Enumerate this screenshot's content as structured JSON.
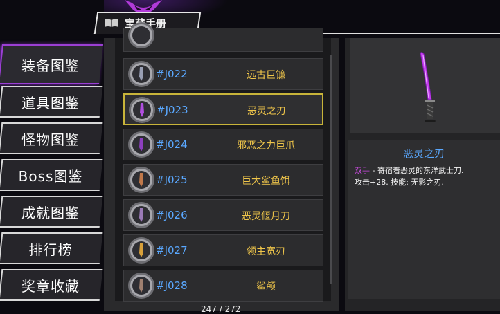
{
  "header": {
    "title": "宝藏手册"
  },
  "nav": [
    {
      "label": "装备图鉴",
      "active": true
    },
    {
      "label": "道具图鉴",
      "active": false
    },
    {
      "label": "怪物图鉴",
      "active": false
    },
    {
      "label": "Boss图鉴",
      "active": false
    },
    {
      "label": "成就图鉴",
      "active": false
    },
    {
      "label": "排行榜",
      "active": false
    },
    {
      "label": "奖章收藏",
      "active": false
    }
  ],
  "items": [
    {
      "code": "#J022",
      "name": "远古巨镰",
      "icon": "scythe-icon",
      "color": "#9aa0b5"
    },
    {
      "code": "#J023",
      "name": "恶灵之刃",
      "icon": "katana-icon",
      "color": "#b04ee0"
    },
    {
      "code": "#J024",
      "name": "邪恶之力巨爪",
      "icon": "claw-icon",
      "color": "#8d3fc0"
    },
    {
      "code": "#J025",
      "name": "巨大鲨鱼饵",
      "icon": "bait-icon",
      "color": "#c0784a"
    },
    {
      "code": "#J026",
      "name": "恶灵偃月刀",
      "icon": "glaive-icon",
      "color": "#9b7ab8"
    },
    {
      "code": "#J027",
      "name": "领主宽刃",
      "icon": "broadblade-icon",
      "color": "#d8a03a"
    },
    {
      "code": "#J028",
      "name": "鲨颅",
      "icon": "shark-skull-icon",
      "color": "#a08070"
    }
  ],
  "selected": {
    "name": "恶灵之刃",
    "tag": "双手",
    "description": " - 寄宿着恶灵的东洋武士刀.",
    "stats": "攻击+28. 技能: 无影之刃."
  },
  "counter": "247 / 272"
}
